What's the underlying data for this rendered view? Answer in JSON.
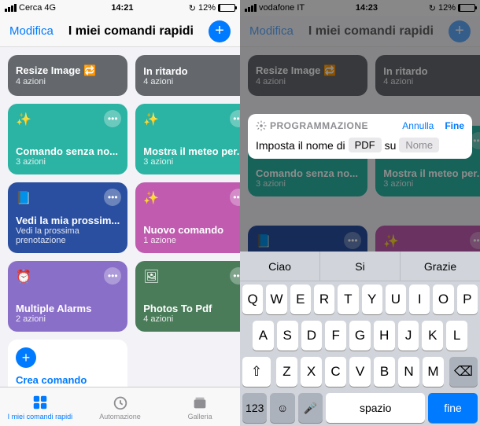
{
  "left": {
    "status": {
      "search": "Cerca",
      "net": "4G",
      "time": "14:21",
      "battery": "12%"
    },
    "nav": {
      "edit": "Modifica",
      "title": "I miei comandi rapidi"
    },
    "cards": [
      {
        "title": "Resize Image 🔁",
        "sub": "4 azioni",
        "color": "#64686d",
        "short": true
      },
      {
        "title": "In ritardo",
        "sub": "4 azioni",
        "color": "#64686d",
        "short": true
      },
      {
        "title": "Comando senza no...",
        "sub": "3 azioni",
        "color": "#2bb3a3",
        "icon": "✨"
      },
      {
        "title": "Mostra il meteo per...",
        "sub": "3 azioni",
        "color": "#2bb3a3",
        "icon": "✨"
      },
      {
        "title": "Vedi la mia prossim...",
        "sub": "Vedi la prossima prenotazione",
        "color": "#2b4fa0",
        "icon": "📘"
      },
      {
        "title": "Nuovo comando",
        "sub": "1 azione",
        "color": "#c05bb0",
        "icon": "✨"
      },
      {
        "title": "Multiple Alarms",
        "sub": "2 azioni",
        "color": "#8a6fc9",
        "icon": "⏰"
      },
      {
        "title": "Photos To Pdf",
        "sub": "4 azioni",
        "color": "#4a7c59",
        "icon": "🖼"
      }
    ],
    "create": "Crea comando rapido",
    "tabs": [
      {
        "l": "I miei comandi rapidi"
      },
      {
        "l": "Automazione"
      },
      {
        "l": "Galleria"
      }
    ]
  },
  "right": {
    "status": {
      "carrier": "vodafone IT",
      "time": "14:23",
      "battery": "12%"
    },
    "nav": {
      "edit": "Modifica",
      "title": "I miei comandi rapidi"
    },
    "sheet": {
      "label": "PROGRAMMAZIONE",
      "cancel": "Annulla",
      "done": "Fine",
      "prefix": "Imposta il nome di",
      "token": "PDF",
      "mid": "su",
      "placeholder": "Nome"
    },
    "suggestions": [
      "Ciao",
      "Si",
      "Grazie"
    ],
    "rows": [
      [
        "Q",
        "W",
        "E",
        "R",
        "T",
        "Y",
        "U",
        "I",
        "O",
        "P"
      ],
      [
        "A",
        "S",
        "D",
        "F",
        "G",
        "H",
        "J",
        "K",
        "L"
      ],
      [
        "Z",
        "X",
        "C",
        "V",
        "B",
        "N",
        "M"
      ]
    ],
    "fn": {
      "num": "123",
      "mic": "🎤",
      "space": "spazio",
      "ret": "fine"
    }
  }
}
